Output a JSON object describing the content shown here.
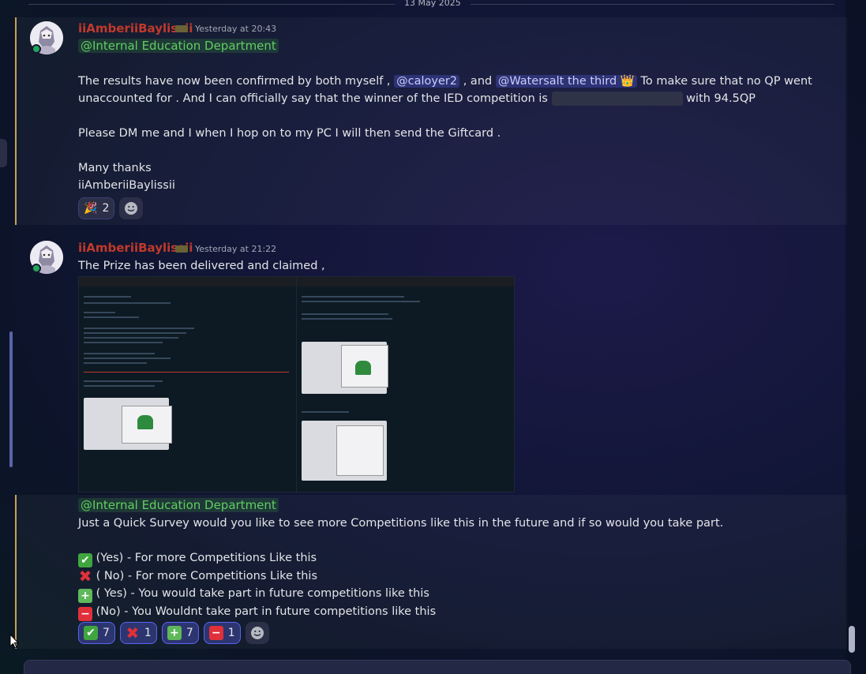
{
  "date_divider": "13 May 2025",
  "messages": [
    {
      "author": "iiAmberiiBaylissii",
      "timestamp": "Yesterday at 20:43",
      "role_mention": "@Internal Education Department",
      "text_1a": "The results have now been confirmed by both myself ,",
      "mention_1": "@caloyer2",
      "text_1b": ", and",
      "mention_2": "@Watersalt the third",
      "mention_2_emoji": "👑",
      "text_1c": "To make sure that no QP went",
      "text_2a": "unaccounted for . And I can officially say that the winner of the IED competition is",
      "text_2b": "with 94.5QP",
      "text_3": "Please DM me and I when I hop on to my PC I will then send the Giftcard .",
      "text_4": "Many thanks",
      "text_5": "iiAmberiiBaylissii",
      "reactions": [
        {
          "emoji": "🎉",
          "count": "2"
        }
      ]
    },
    {
      "author": "iiAmberiiBaylissii",
      "timestamp": "Yesterday at 21:22",
      "text": "The Prize has been delivered and claimed ,"
    },
    {
      "role_mention": "@Internal Education Department",
      "text_1": "Just a Quick Survey would you like to see more Competitions like this in the future and if so would you take part.",
      "options": [
        {
          "emoji": "✔",
          "text": "(Yes) - For more Competitions Like this"
        },
        {
          "emoji": "✖",
          "text": "( No) - For more Competitions Like this"
        },
        {
          "emoji": "+",
          "text": "( Yes) - You would take part in future competitions like this"
        },
        {
          "emoji": "−",
          "text": "(No) - You Wouldnt take part in future competitions like this"
        }
      ],
      "reactions": [
        {
          "emoji": "✔",
          "count": "7"
        },
        {
          "emoji": "✖",
          "count": "1"
        },
        {
          "emoji": "+",
          "count": "7"
        },
        {
          "emoji": "−",
          "count": "1"
        }
      ]
    }
  ],
  "colors": {
    "username": "#c0392b",
    "role_mention": "#5fcf5f",
    "accent": "#5865f2"
  }
}
